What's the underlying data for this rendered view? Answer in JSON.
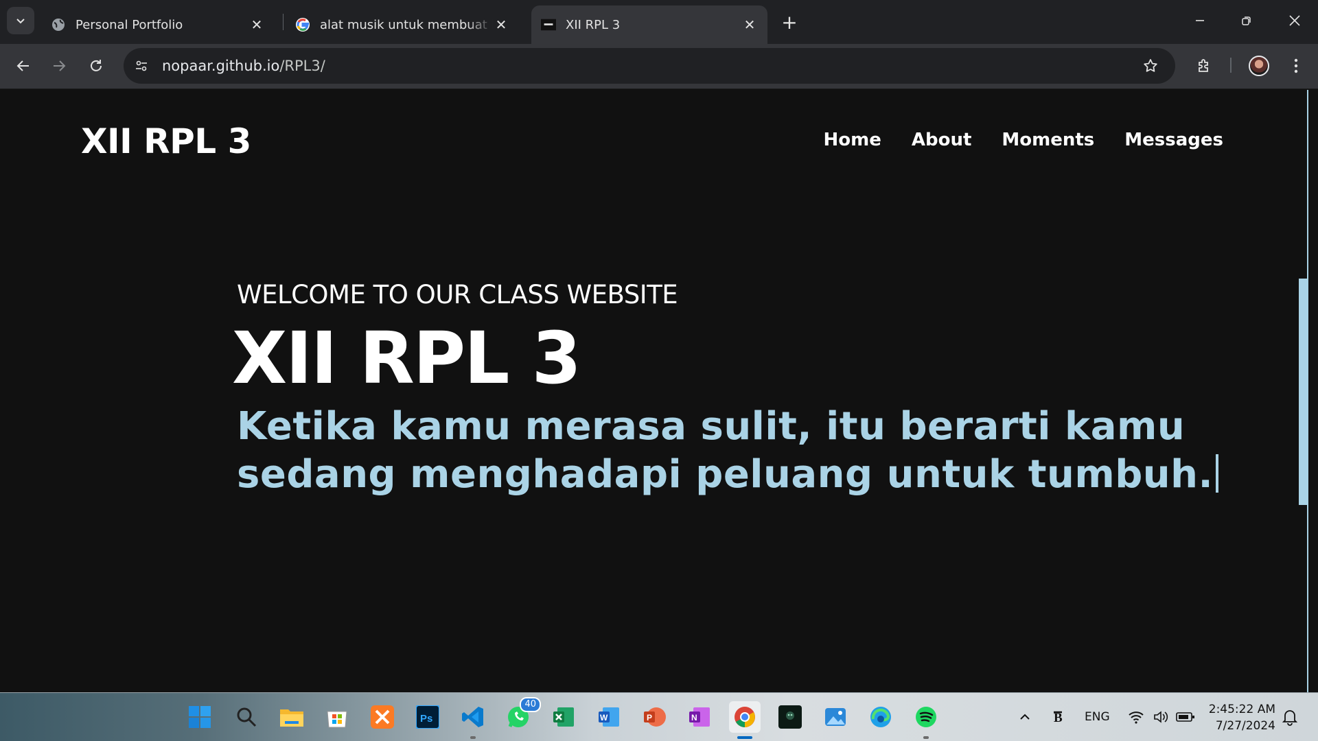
{
  "browser": {
    "tabs": [
      {
        "title": "Personal Portfolio",
        "favicon": "globe-icon",
        "active": false
      },
      {
        "title": "alat musik untuk membuat band",
        "favicon": "google-icon",
        "active": false
      },
      {
        "title": "XII RPL 3",
        "favicon": "site-thumbnail-icon",
        "active": true
      }
    ],
    "url_host": "nopaar.github.io",
    "url_path": "/RPL3/"
  },
  "site": {
    "logo": "XII RPL 3",
    "nav": [
      "Home",
      "About",
      "Moments",
      "Messages"
    ],
    "hero": {
      "subtitle": "WELCOME TO OUR CLASS WEBSITE",
      "title": "XII RPL 3",
      "quote": "Ketika kamu merasa sulit, itu berarti kamu sedang menghadapi peluang untuk tumbuh."
    },
    "colors": {
      "background": "#111111",
      "accent": "#aad3e6",
      "text": "#ffffff"
    }
  },
  "taskbar": {
    "apps": [
      "windows-start-icon",
      "search-icon",
      "file-explorer-icon",
      "microsoft-store-icon",
      "xampp-icon",
      "photoshop-icon",
      "vscode-icon",
      "whatsapp-icon",
      "excel-icon",
      "word-icon",
      "powerpoint-icon",
      "onenote-icon",
      "chrome-icon",
      "terminal-app-icon",
      "photos-icon",
      "edge-icon",
      "spotify-icon"
    ],
    "whatsapp_badge": "40",
    "language": "ENG",
    "time": "2:45:22 AM",
    "date": "7/27/2024"
  }
}
